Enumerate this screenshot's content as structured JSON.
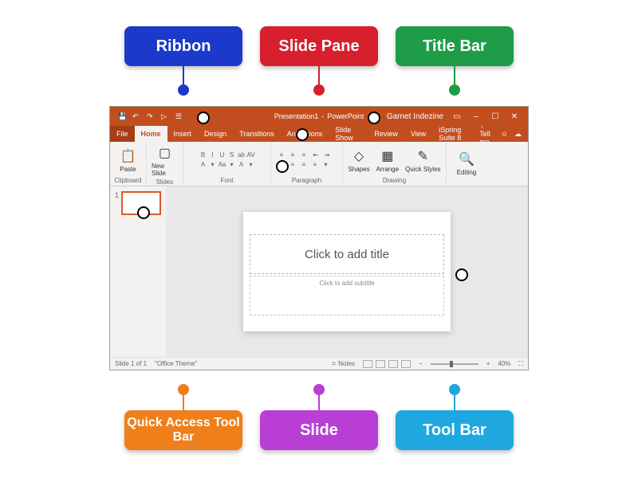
{
  "labels": {
    "ribbon": "Ribbon",
    "slide_pane": "Slide Pane",
    "title_bar": "Title Bar",
    "qat": "Quick Access Tool Bar",
    "slide": "Slide",
    "tool_bar": "Tool Bar"
  },
  "colors": {
    "ribbon": "#1b3ac9",
    "slide_pane": "#d71f2e",
    "title_bar": "#1e9c48",
    "qat": "#ee7f1a",
    "slide": "#b93ed6",
    "tool_bar": "#1fa8e0"
  },
  "app": {
    "title_doc": "Presentation1",
    "title_app": "PowerPoint",
    "title_user": "Garnet Indezine",
    "tabs": [
      "File",
      "Home",
      "Insert",
      "Design",
      "Transitions",
      "Animations",
      "Slide Show",
      "Review",
      "View",
      "iSpring Suite 8"
    ],
    "tell_me": "Tell me",
    "ribbon_groups": {
      "clipboard": "Clipboard",
      "slides": "Slides",
      "font": "Font",
      "paragraph": "Paragraph",
      "drawing": "Drawing",
      "editing": "Editing"
    },
    "btns": {
      "paste": "Paste",
      "new_slide": "New Slide",
      "shapes": "Shapes",
      "arrange": "Arrange",
      "quick_styles": "Quick Styles",
      "editing": "Editing"
    },
    "slide_title_ph": "Click to add title",
    "slide_sub_ph": "Click to add subtitle",
    "status": {
      "slide_of": "Slide 1 of 1",
      "theme": "\"Office Theme\"",
      "notes": "Notes",
      "zoom": "40%"
    }
  }
}
